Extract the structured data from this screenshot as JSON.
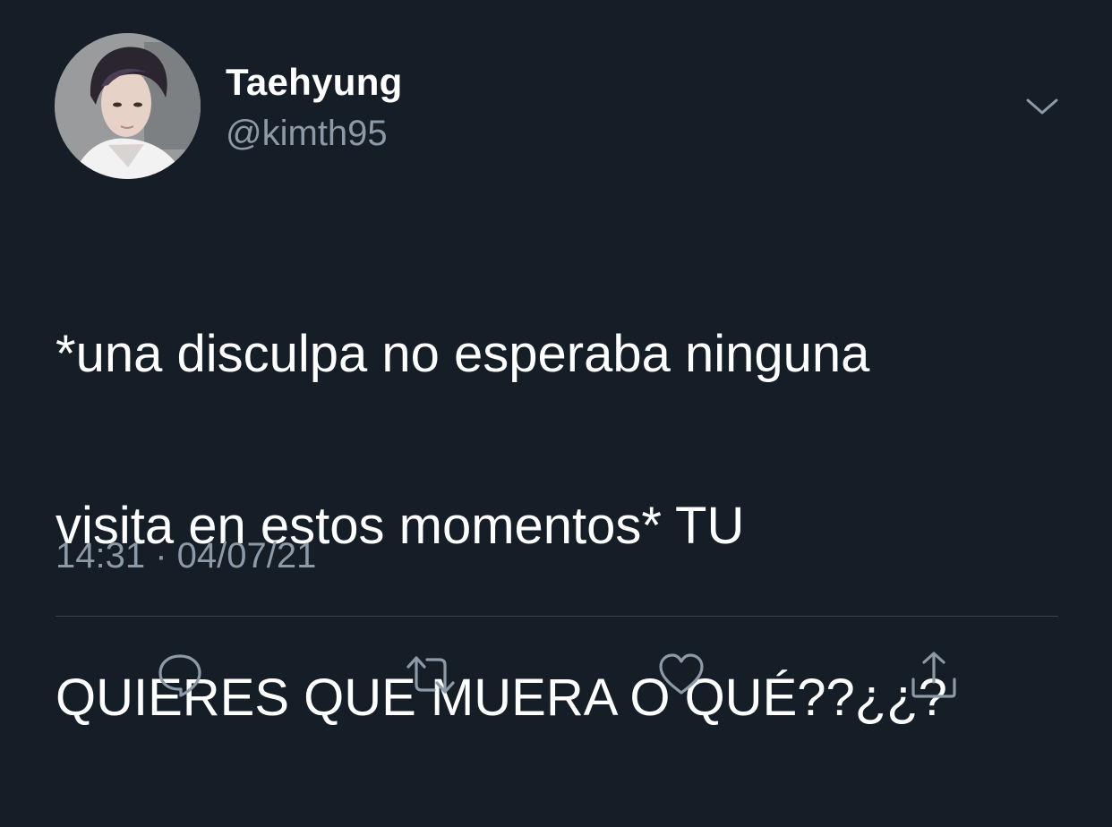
{
  "tweet": {
    "author": {
      "display_name": "Taehyung",
      "handle": "@kimth95",
      "avatar_icon": "profile-photo"
    },
    "text_lines": [
      "*una disculpa no esperaba ninguna",
      "visita en estos momentos* TU",
      "QUIERES QUE MUERA O QUÉ??¿¿?"
    ],
    "timestamp": "14:31 · 04/07/21",
    "menu_icon": "chevron-down-icon",
    "actions": [
      {
        "icon": "reply-icon"
      },
      {
        "icon": "retweet-icon"
      },
      {
        "icon": "like-icon"
      },
      {
        "icon": "share-icon"
      }
    ]
  },
  "colors": {
    "background": "#151d27",
    "primary_text": "#ffffff",
    "secondary_text": "#8c99a6",
    "divider": "#38444d"
  }
}
